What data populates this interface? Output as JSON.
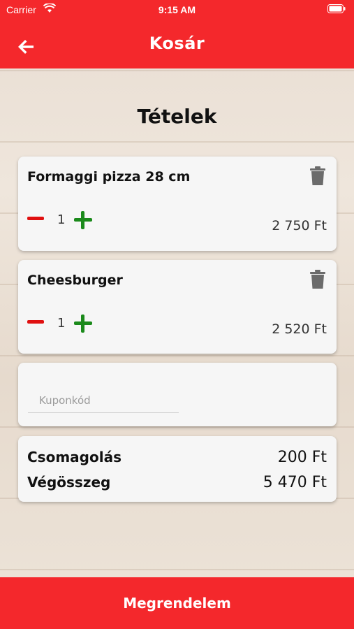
{
  "status_bar": {
    "carrier": "Carrier",
    "time": "9:15 AM"
  },
  "header": {
    "title": "Kosár"
  },
  "section": {
    "title": "Tételek"
  },
  "items": [
    {
      "name": "Formaggi pizza 28 cm",
      "quantity": "1",
      "price": "2 750 Ft"
    },
    {
      "name": "Cheesburger",
      "quantity": "1",
      "price": "2 520 Ft"
    }
  ],
  "coupon": {
    "placeholder": "Kuponkód",
    "value": ""
  },
  "summary": {
    "packaging_label": "Csomagolás",
    "packaging_value": "200 Ft",
    "total_label": "Végösszeg",
    "total_value": "5 470 Ft"
  },
  "order_button": {
    "label": "Megrendelem"
  },
  "colors": {
    "accent": "#f4282c",
    "plus": "#1b8a1b",
    "minus": "#e01010"
  },
  "icons": {
    "back": "arrow-left-icon",
    "delete": "trash-icon",
    "wifi": "wifi-icon",
    "battery": "battery-icon"
  }
}
